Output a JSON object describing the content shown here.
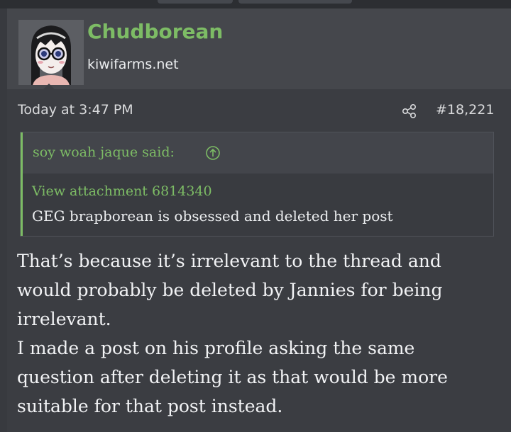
{
  "post": {
    "username": "Chudborean",
    "user_title": "kiwifarms.net",
    "timestamp": "Today at 3:47 PM",
    "post_number": "#18,221",
    "quote": {
      "author_line": "soy woah jaque said:",
      "attachment_link": "View attachment 6814340",
      "text": "GEG brapborean is obsessed and deleted her post"
    },
    "body_lines": [
      "That’s because it’s irrelevant to the thread and",
      "would probably be deleted by Jannies for being",
      "irrelevant.",
      "I made a post on his profile asking the same",
      "question after deleting it as that would be more",
      "suitable for that post instead."
    ]
  },
  "colors": {
    "accent": "#7dbc65",
    "background": "#383a3f",
    "header_background": "#45474c",
    "text": "#f2f3f5"
  },
  "icons": {
    "share": "share-icon",
    "quote_jump": "arrow-up-circle-icon"
  }
}
